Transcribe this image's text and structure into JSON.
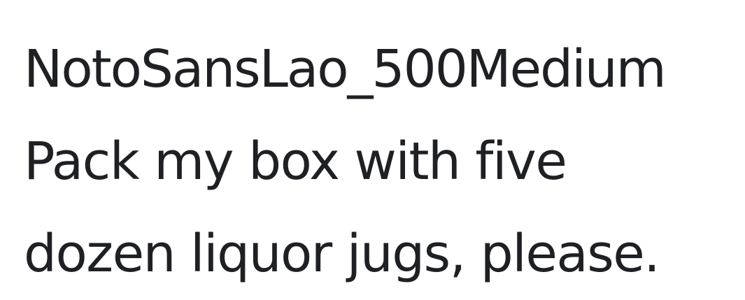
{
  "font_name": "NotoSansLao_500Medium",
  "sample_lines": [
    "Pack my box with five",
    "dozen liquor jugs, please."
  ],
  "colors": {
    "text": "#1f2024",
    "background": "#ffffff"
  }
}
